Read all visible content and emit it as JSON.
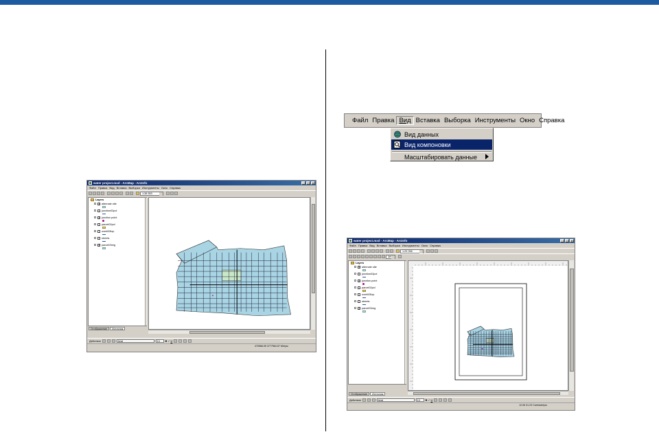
{
  "menu": {
    "items": [
      "Файл",
      "Правка",
      "Вид",
      "Вставка",
      "Выборка",
      "Инструменты",
      "Окно",
      "Справка"
    ],
    "dropdown": [
      "Вид данных",
      "Вид компоновки",
      "Масштабировать данные"
    ]
  },
  "left_window": {
    "title": "water project.mxd - ArcMap - ArcInfo",
    "menu": [
      "Файл",
      "Правка",
      "Вид",
      "Вставка",
      "Выборка",
      "Инструменты",
      "Окно",
      "Справка"
    ],
    "scale": "1:38 553",
    "toc_root": "Layers",
    "layers": [
      {
        "name": "alternate site",
        "checked": true,
        "symbol": "box"
      },
      {
        "name": "junction02pol",
        "checked": false,
        "symbol": "line"
      },
      {
        "name": "junction point",
        "checked": true,
        "symbol": "dot"
      },
      {
        "name": "parcel02pol",
        "checked": false,
        "symbol": "tan"
      },
      {
        "name": "overli03lop",
        "checked": false,
        "symbol": "line"
      },
      {
        "name": "streets",
        "checked": false,
        "symbol": "line"
      },
      {
        "name": "parcel03reg",
        "checked": true,
        "symbol": "box"
      }
    ],
    "tabs": [
      "Отображение",
      "Источник"
    ],
    "draw_label": "Действия",
    "font": "Arial",
    "font_size": "10",
    "status": "470568.05 3777564.57 Метры"
  },
  "right_window": {
    "title": "water project.mxd - ArcMap - ArcInfo",
    "menu": [
      "Файл",
      "Правка",
      "Вид",
      "Вставка",
      "Выборка",
      "Инструменты",
      "Окно",
      "Справка"
    ],
    "scale": "1:29 266",
    "zoom": "38%",
    "toc_root": "Layers",
    "layers": [
      {
        "name": "alternate site",
        "checked": true,
        "symbol": "box"
      },
      {
        "name": "junction02pol",
        "checked": false,
        "symbol": "line"
      },
      {
        "name": "junction point",
        "checked": true,
        "symbol": "dot"
      },
      {
        "name": "parcel02pol",
        "checked": false,
        "symbol": "tan"
      },
      {
        "name": "overli03lop",
        "checked": false,
        "symbol": "line"
      },
      {
        "name": "streets",
        "checked": false,
        "symbol": "line"
      },
      {
        "name": "parcel03reg",
        "checked": true,
        "symbol": "box"
      }
    ],
    "tabs": [
      "Отображение",
      "Источник"
    ],
    "draw_label": "Действия",
    "font": "Arial",
    "font_size": "10",
    "status": "12.06 31.23 Сантиметры"
  },
  "colors": {
    "title_bar": "#0a246a",
    "parcel_fill": "#a8d4e4",
    "highlight_fill": "#c8e8c8",
    "selected_menu": "#0a246a",
    "top_rule": "#1d5aa0"
  }
}
